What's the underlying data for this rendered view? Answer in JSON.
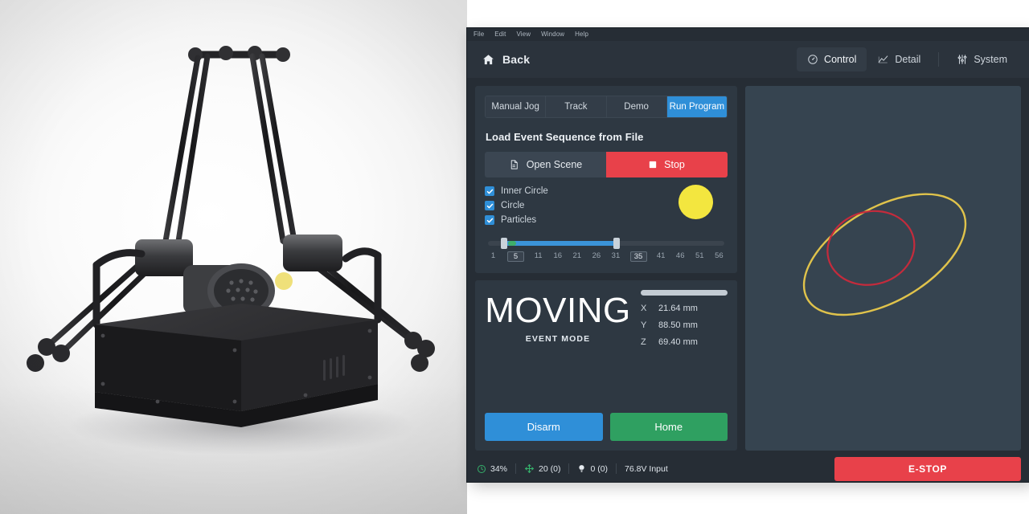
{
  "menubar": {
    "items": [
      "File",
      "Edit",
      "View",
      "Window",
      "Help"
    ]
  },
  "topbar": {
    "back_label": "Back",
    "back_icon": "home-icon",
    "nav": [
      {
        "label": "Control",
        "icon": "gauge-circle-icon",
        "active": true
      },
      {
        "label": "Detail",
        "icon": "line-chart-icon",
        "active": false
      },
      {
        "label": "System",
        "icon": "sliders-icon",
        "active": false
      }
    ]
  },
  "control_panel": {
    "tabs": [
      {
        "label": "Manual Jog",
        "active": false
      },
      {
        "label": "Track",
        "active": false
      },
      {
        "label": "Demo",
        "active": false
      },
      {
        "label": "Run Program",
        "active": true
      }
    ],
    "section_title": "Load Event Sequence from File",
    "open_scene_label": "Open Scene",
    "open_scene_icon": "file-open-icon",
    "stop_label": "Stop",
    "stop_icon": "stop-square-icon",
    "checkboxes": [
      {
        "label": "Inner Circle",
        "checked": true
      },
      {
        "label": "Circle",
        "checked": true
      },
      {
        "label": "Particles",
        "checked": true
      }
    ],
    "indicator_color": "#f3e63f",
    "slider": {
      "min": 1,
      "max": 56,
      "low": 5,
      "high": 35,
      "ticks": [
        "1",
        "5",
        "11",
        "16",
        "21",
        "26",
        "31",
        "35",
        "41",
        "46",
        "51",
        "56"
      ],
      "boxed_ticks": [
        "5",
        "35"
      ]
    }
  },
  "status_panel": {
    "state": "MOVING",
    "mode": "EVENT MODE",
    "coordinates": [
      {
        "axis": "X",
        "value": "21.64 mm"
      },
      {
        "axis": "Y",
        "value": "88.50 mm"
      },
      {
        "axis": "Z",
        "value": "69.40 mm"
      }
    ],
    "disarm_label": "Disarm",
    "home_label": "Home"
  },
  "viewport": {
    "paths": [
      {
        "name": "outer-path",
        "color": "#e0c34b"
      },
      {
        "name": "inner-path",
        "color": "#c42b3c"
      }
    ]
  },
  "footer": {
    "items": [
      {
        "icon": "clock-icon",
        "text": "34%",
        "color": "#35b06b"
      },
      {
        "icon": "move-arrows-icon",
        "text": "20 (0)",
        "color": "#35b06b"
      },
      {
        "icon": "bulb-icon",
        "text": "0 (0)",
        "color": "#e6ebf0"
      },
      {
        "icon": "none",
        "text": "76.8V Input",
        "color": "#dfe5eb"
      }
    ],
    "estop_label": "E-STOP",
    "estop_color": "#e8414a"
  }
}
